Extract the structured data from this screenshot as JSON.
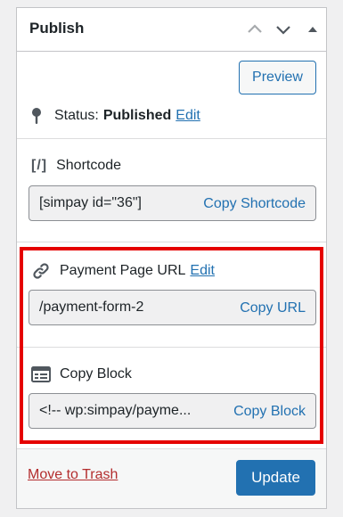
{
  "panel": {
    "title": "Publish"
  },
  "preview_label": "Preview",
  "status": {
    "label": "Status:",
    "value": "Published",
    "edit_label": "Edit"
  },
  "shortcode": {
    "icon_text": "[/]",
    "label": "Shortcode",
    "value": "[simpay id=\"36\"]",
    "copy_label": "Copy Shortcode"
  },
  "payment_url": {
    "label": "Payment Page URL",
    "edit_label": "Edit",
    "value": "/payment-form-2",
    "copy_label": "Copy URL"
  },
  "block": {
    "label": "Copy Block",
    "value": "<!-- wp:simpay/payme...",
    "copy_label": "Copy Block"
  },
  "footer": {
    "trash_label": "Move to Trash",
    "update_label": "Update"
  },
  "colors": {
    "accent": "#2271b1",
    "highlight": "#e50000",
    "danger": "#b32d2e"
  }
}
